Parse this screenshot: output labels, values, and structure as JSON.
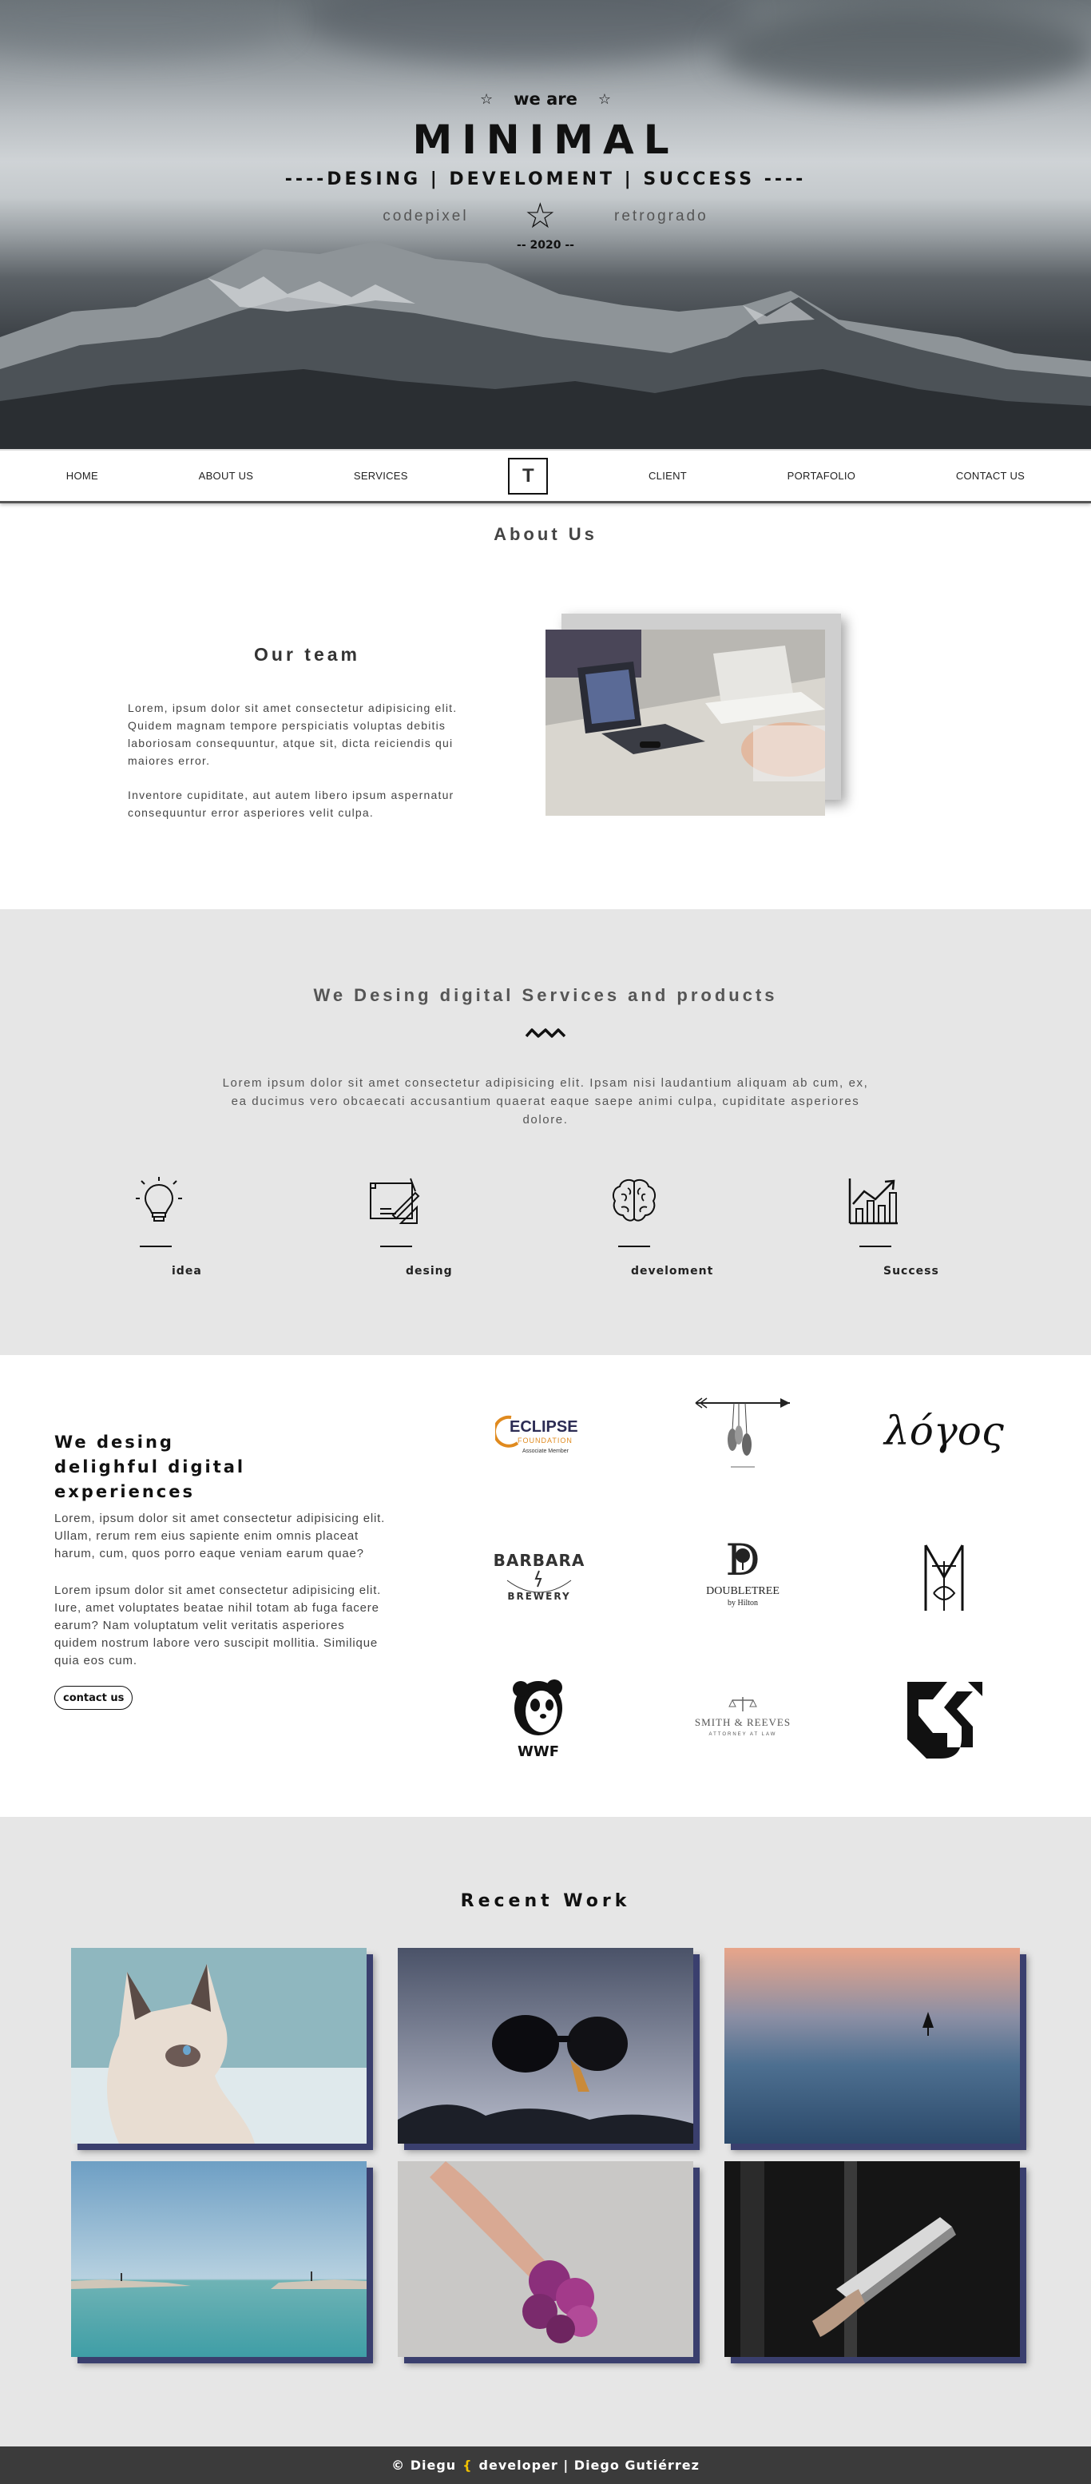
{
  "hero": {
    "we_are": "we are",
    "title": "MINIMAL",
    "tagline": "----DESING | DEVELOMENT | SUCCESS ----",
    "left_sub": "codepixel",
    "right_sub": "retrogrado",
    "year": "-- 2020 --"
  },
  "nav": {
    "items": [
      "HOME",
      "ABOUT US",
      "SERVICES",
      "CLIENT",
      "PORTAFOLIO",
      "CONTACT US"
    ],
    "logo": "T"
  },
  "about": {
    "title": "About Us",
    "team_title": "Our team",
    "paragraph1": "Lorem, ipsum dolor sit amet consectetur adipisicing elit. Quidem magnam tempore perspiciatis voluptas debitis laboriosam consequuntur, atque sit, dicta reiciendis qui maiores error.",
    "paragraph2": "Inventore cupiditate, aut autem libero ipsum aspernatur consequuntur error asperiores velit culpa."
  },
  "services": {
    "title": "We Desing digital Services and products",
    "description": "Lorem ipsum dolor sit amet consectetur adipisicing elit. Ipsam nisi laudantium aliquam ab cum, ex, ea ducimus vero obcaecati accusantium quaerat eaque saepe animi culpa, cupiditate asperiores dolore.",
    "items": [
      {
        "label": "idea",
        "icon": "lightbulb-icon"
      },
      {
        "label": "desing",
        "icon": "blueprint-icon"
      },
      {
        "label": "develoment",
        "icon": "brain-icon"
      },
      {
        "label": "Success",
        "icon": "growth-chart-icon"
      }
    ]
  },
  "clients": {
    "heading": "We desing delighful digital experiences",
    "paragraph1": "Lorem, ipsum dolor sit amet consectetur adipisicing elit. Ullam, rerum rem eius sapiente enim omnis placeat harum, cum, quos porro eaque veniam earum quae?",
    "paragraph2": "Lorem ipsum dolor sit amet consectetur adipisicing elit. Iure, amet voluptates beatae nihil totam ab fuga facere earum? Nam voluptatum velit veritatis asperiores quidem nostrum labore vero suscipit mollitia. Similique quia eos cum.",
    "button": "contact us",
    "logos": {
      "eclipse": {
        "name": "ECLIPSE",
        "sub": "FOUNDATION",
        "tag": "Associate Member"
      },
      "logos_greek": "λόγος",
      "barbara": {
        "name": "BARBARA",
        "sub": "BREWERY"
      },
      "doubletree": {
        "name": "DOUBLETREE",
        "sub": "by Hilton"
      },
      "wwf": "WWF",
      "smith": {
        "name": "SMITH & REEVES",
        "sub": "ATTORNEY AT LAW"
      }
    }
  },
  "work": {
    "title": "Recent Work"
  },
  "footer": {
    "copyright": "© Diegu",
    "brace": "{",
    "text": "developer | Diego Gutiérrez"
  }
}
